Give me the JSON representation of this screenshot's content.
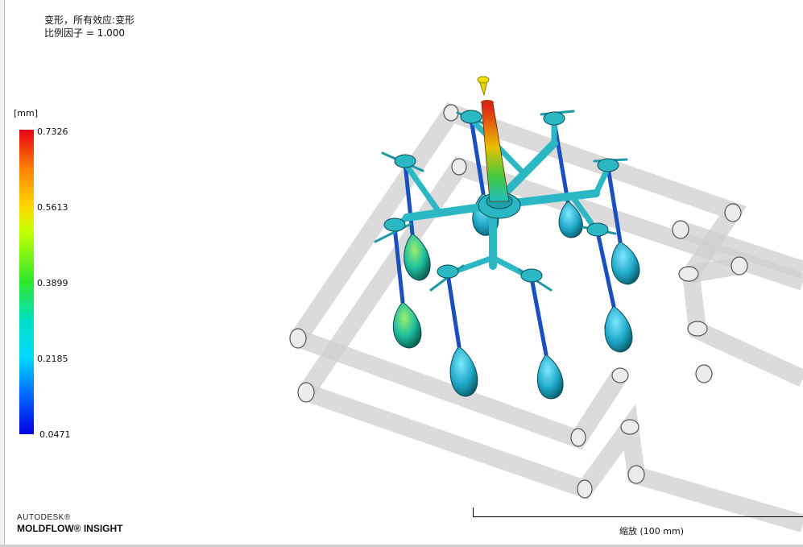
{
  "title": {
    "line1": "变形，所有效应:变形",
    "line2": "比例因子 = 1.000"
  },
  "legend": {
    "unit": "[mm]",
    "ticks": [
      "0.7326",
      "0.5613",
      "0.3899",
      "0.2185",
      "0.0471"
    ],
    "colors": [
      "#e8001a",
      "#ffd800",
      "#2ee82a",
      "#00d8ff",
      "#0000e0"
    ]
  },
  "logo": {
    "line1": "AUTODESK®",
    "line2": "MOLDFLOW® INSIGHT"
  },
  "scale": {
    "label": "缩放 (100 mm)"
  },
  "model": {
    "runner_color": "#2bb8c4",
    "sprue_colors": [
      "#e82a10",
      "#f0c000",
      "#18c8b8"
    ],
    "cooling_color": "#d4d4d4"
  }
}
